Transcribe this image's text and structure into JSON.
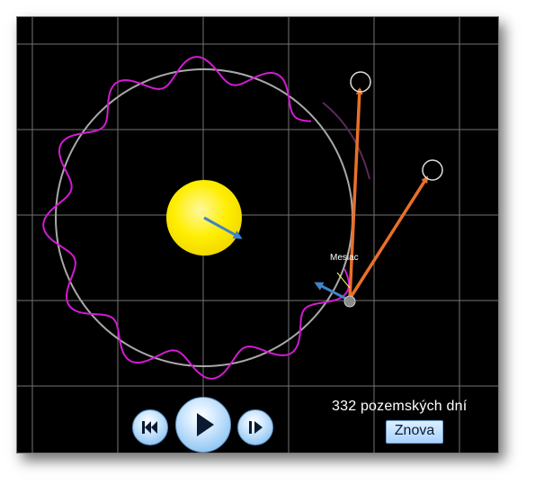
{
  "sim": {
    "days_label": "332 pozemských dní",
    "reset_label": "Znova",
    "moon_label": "Mesiac"
  },
  "controls": {
    "rewind_icon": "skip-to-start-icon",
    "play_icon": "play-icon",
    "step_icon": "step-forward-icon"
  },
  "colors": {
    "background": "#000000",
    "grid": "#9a9a9a",
    "earth_orbit": "#a9a9a9",
    "moon_path": "#d21bd2",
    "sun": "#ffee00",
    "force_arrow": "#e8702a",
    "velocity_arrow": "#3d85c6"
  }
}
